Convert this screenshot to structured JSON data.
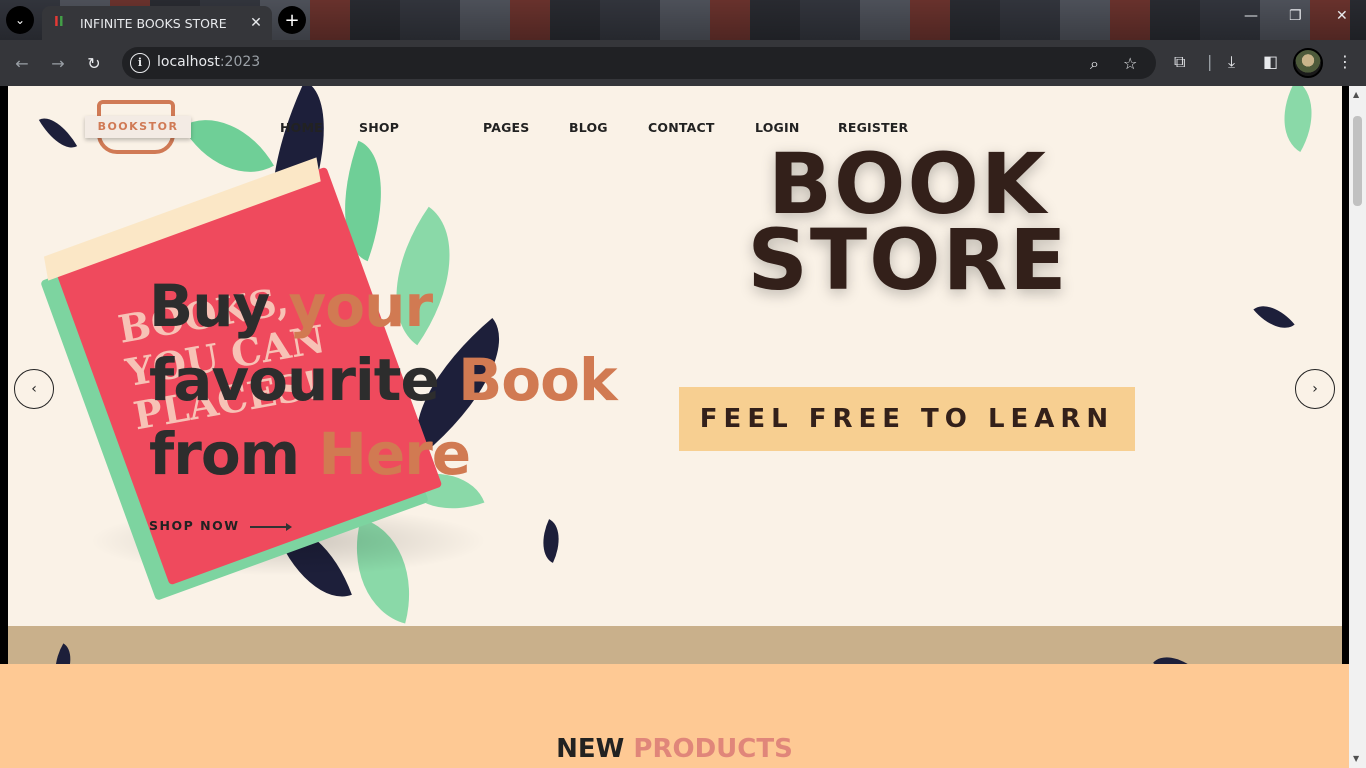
{
  "browser": {
    "tab_title": "INFINITE BOOKS STORE",
    "tab_close": "✕",
    "new_tab": "+",
    "url_host": "localhost",
    "url_port": ":2023",
    "window_controls": [
      "—",
      "❐",
      "✕"
    ]
  },
  "site": {
    "logo_text": "BOOKSTOR",
    "nav": [
      "HOME",
      "SHOP",
      "PAGES",
      "BLOG",
      "CONTACT",
      "LOGIN",
      "REGISTER"
    ],
    "hero": {
      "line1_plain": "Buy ",
      "line1_accent": "your",
      "line2_plain": "favourite ",
      "line2_accent": "Book",
      "line3_plain": "from ",
      "line3_accent": "Here",
      "shop_now": "SHOP NOW",
      "big_title_line1": "BOOK",
      "big_title_line2": "STORE",
      "cta": "FEEL FREE TO LEARN",
      "book_cover_text": "BOOKS, YOU CAN PLACES!"
    },
    "slider": {
      "prev": "‹",
      "next": "›"
    },
    "new_products": {
      "plain": "NEW ",
      "accent": "PRODUCTS"
    }
  },
  "colors": {
    "accent": "#d17a52",
    "hero_bg": "#faf2e7",
    "band": "#c9b08b",
    "section_bg": "#fec994",
    "cta_bg": "#f7cf91"
  }
}
